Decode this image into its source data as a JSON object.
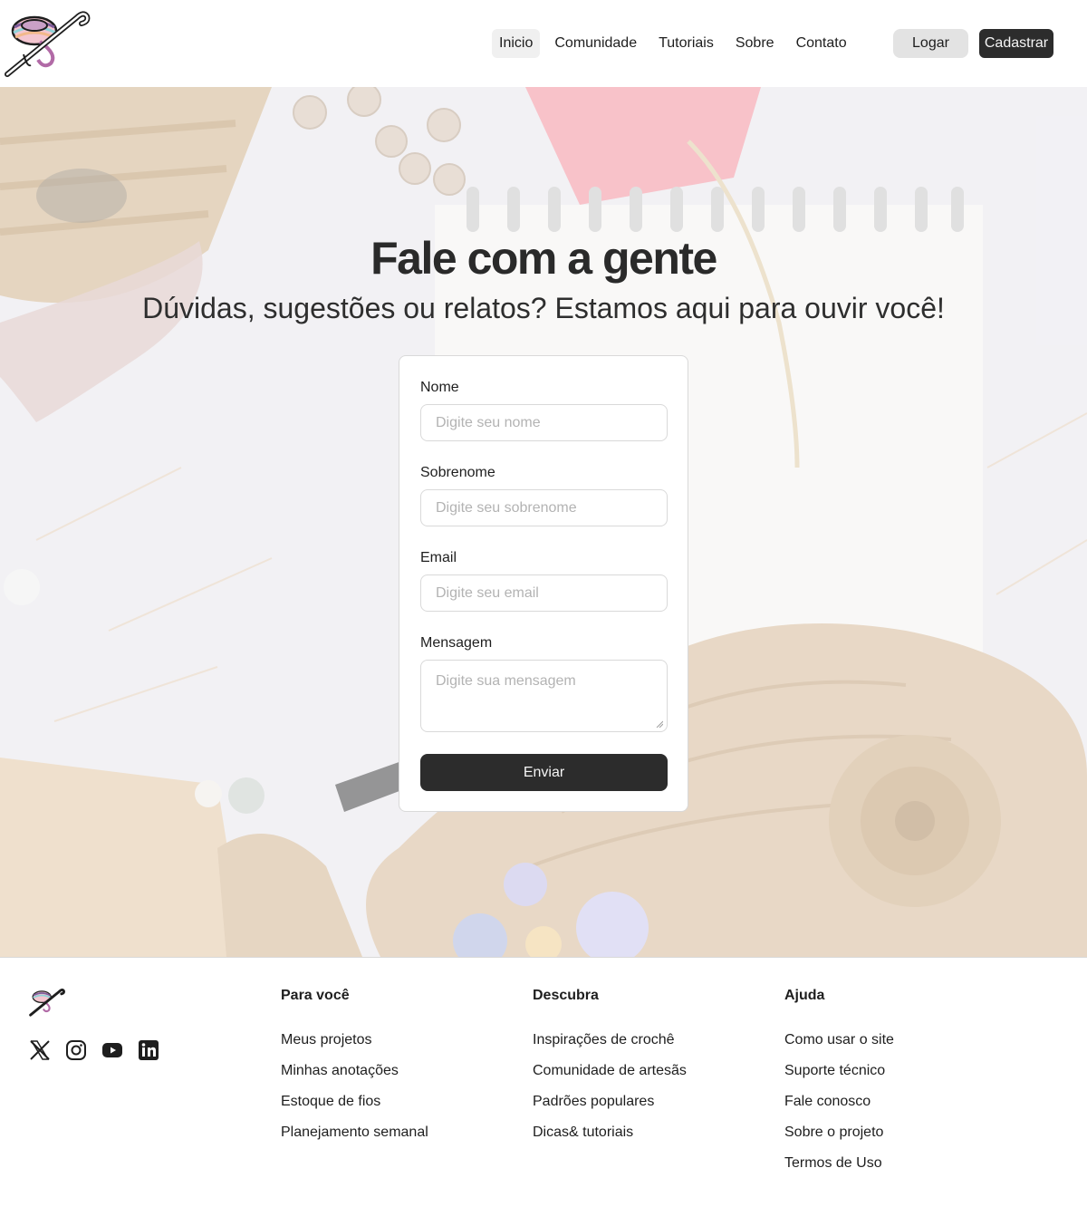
{
  "header": {
    "logo_icon": "yarn-crochet-hook-logo",
    "nav": [
      {
        "label": "Inicio",
        "active": true
      },
      {
        "label": "Comunidade",
        "active": false
      },
      {
        "label": "Tutoriais",
        "active": false
      },
      {
        "label": "Sobre",
        "active": false
      },
      {
        "label": "Contato",
        "active": false
      }
    ],
    "login_label": "Logar",
    "signup_label": "Cadastrar"
  },
  "hero": {
    "title": "Fale com a gente",
    "subtitle": "Dúvidas, sugestões ou relatos? Estamos aqui para ouvir você!"
  },
  "form": {
    "fields": [
      {
        "label": "Nome",
        "placeholder": "Digite seu nome"
      },
      {
        "label": "Sobrenome",
        "placeholder": "Digite seu sobrenome"
      },
      {
        "label": "Email",
        "placeholder": "Digite seu email"
      }
    ],
    "message": {
      "label": "Mensagem",
      "placeholder": "Digite sua mensagem"
    },
    "submit_label": "Enviar"
  },
  "footer": {
    "socials": [
      "x-icon",
      "instagram-icon",
      "youtube-icon",
      "linkedin-icon"
    ],
    "columns": [
      {
        "title": "Para você",
        "links": [
          "Meus projetos",
          "Minhas anotações",
          "Estoque de fios",
          "Planejamento semanal"
        ]
      },
      {
        "title": "Descubra",
        "links": [
          "Inspirações de crochê",
          "Comunidade de artesãs",
          "Padrões populares",
          "Dicas& tutoriais"
        ]
      },
      {
        "title": "Ajuda",
        "links": [
          "Como usar o site",
          "Suporte técnico",
          "Fale conosco",
          "Sobre o projeto",
          "Termos de Uso"
        ]
      }
    ]
  },
  "colors": {
    "primary_button": "#2c2c2c",
    "secondary_button": "#e3e3e3",
    "border": "#d9d9d9",
    "placeholder": "#b3b3b3"
  }
}
